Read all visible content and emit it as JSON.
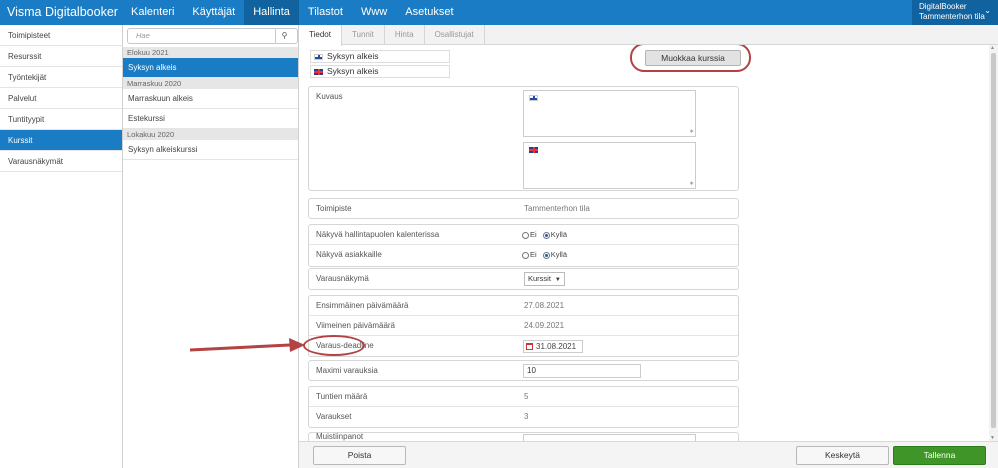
{
  "app": {
    "title": "Visma Digitalbooker"
  },
  "topnav": {
    "items": [
      "Kalenteri",
      "Käyttäjät",
      "Hallinta",
      "Tilastot",
      "Www",
      "Asetukset"
    ],
    "active": "Hallinta"
  },
  "account": {
    "line1": "DigitalBooker",
    "line2": "Tammenterhon tila",
    "chevron_icon": "chevron-down-icon"
  },
  "sidebar": {
    "items": [
      "Toimipisteet",
      "Resurssit",
      "Työntekijät",
      "Palvelut",
      "Tuntityypit",
      "Kurssit",
      "Varausnäkymät"
    ],
    "active": "Kurssit"
  },
  "search": {
    "placeholder": "Hae",
    "icon": "search-icon"
  },
  "courselist": {
    "groups": [
      {
        "heading": "Elokuu 2021",
        "courses": [
          "Syksyn alkeis"
        ]
      },
      {
        "heading": "Marraskuu 2020",
        "courses": [
          "Marraskuun alkeis",
          "Estekurssi"
        ]
      },
      {
        "heading": "Lokakuu 2020",
        "courses": [
          "Syksyn alkeiskurssi"
        ]
      }
    ],
    "active": "Syksyn alkeis"
  },
  "tabs": {
    "items": [
      "Tiedot",
      "Tunnit",
      "Hinta",
      "Osallistujat"
    ],
    "active": "Tiedot"
  },
  "names": {
    "fi": "Syksyn alkeis",
    "en": "Syksyn alkeis"
  },
  "edit_button": "Muokkaa kurssia",
  "form": {
    "description_label": "Kuvaus",
    "location_label": "Toimipiste",
    "location_value": "Tammenterhon tila",
    "visible_admin_label": "Näkyvä hallintapuolen kalenterissa",
    "visible_customers_label": "Näkyvä asiakkaille",
    "radio_no": "Ei",
    "radio_yes": "Kyllä",
    "visible_admin": "Kyllä",
    "visible_customers": "Kyllä",
    "booking_view_label": "Varausnäkymä",
    "booking_view_value": "Kurssit",
    "first_date_label": "Ensimmäinen päivämäärä",
    "first_date_value": "27.08.2021",
    "last_date_label": "Viimeinen päivämäärä",
    "last_date_value": "24.09.2021",
    "deadline_label": "Varaus-deadline",
    "deadline_value": "31.08.2021",
    "max_bookings_label": "Maximi varauksia",
    "max_bookings_value": "10",
    "hours_label": "Tuntien määrä",
    "hours_value": "5",
    "bookings_label": "Varaukset",
    "bookings_value": "3",
    "notes_label": "Muistiinpanot"
  },
  "bottom": {
    "delete": "Poista",
    "cancel": "Keskeytä",
    "save": "Tallenna"
  },
  "colors": {
    "primary": "#1a7cc4",
    "primary_dark": "#11639f",
    "save_green": "#3f9528",
    "annotation_red": "#b34242"
  }
}
